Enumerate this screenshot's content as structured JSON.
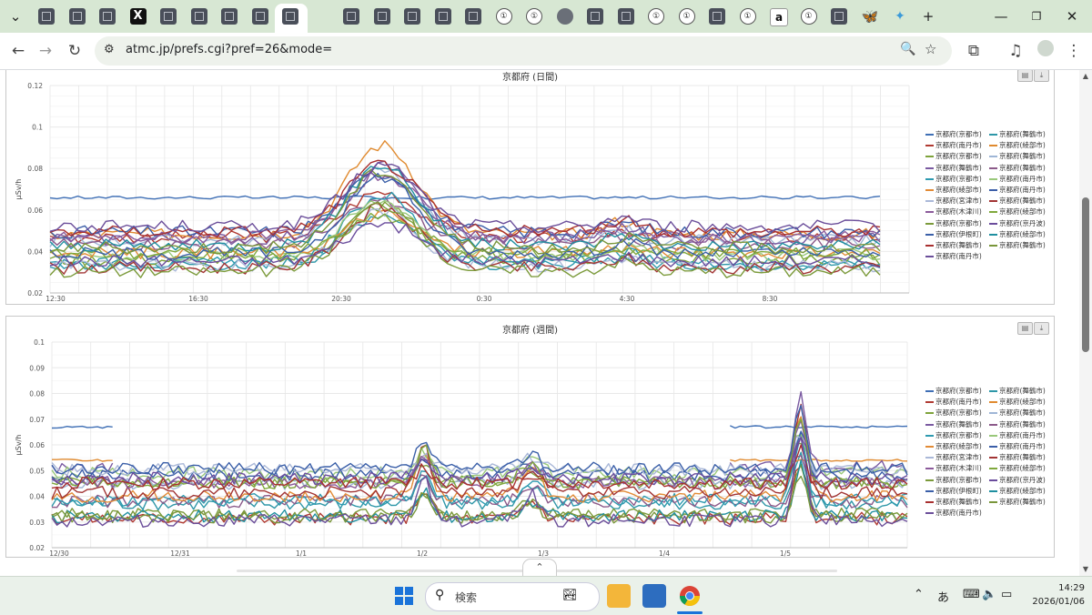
{
  "browser": {
    "tab_icons": [
      "site",
      "site",
      "site",
      "x",
      "site",
      "site",
      "site",
      "site",
      "site",
      "active",
      "site",
      "site",
      "site",
      "site",
      "site",
      "circ",
      "circ",
      "globe",
      "site",
      "site",
      "circ",
      "circ",
      "site",
      "circ",
      "amz",
      "circ",
      "site",
      "bfly",
      "star"
    ],
    "url": "atmc.jp/prefs.cgi?pref=26&mode="
  },
  "legend_names": [
    "京都府(京都市)",
    "京都府(舞鶴市)",
    "京都府(南丹市)",
    "京都府(綾部市)",
    "京都府(京都市)",
    "京都府(舞鶴市)",
    "京都府(舞鶴市)",
    "京都府(舞鶴市)",
    "京都府(京都市)",
    "京都府(南丹市)",
    "京都府(綾部市)",
    "京都府(南丹市)",
    "京都府(宮津市)",
    "京都府(舞鶴市)",
    "京都府(木津川)",
    "京都府(綾部市)",
    "京都府(京都市)",
    "京都府(京丹波)",
    "京都府(伊根町)",
    "京都府(綾部市)",
    "京都府(舞鶴市)",
    "京都府(舞鶴市)",
    "京都府(南丹市)"
  ],
  "legend_colors": [
    "#3f6fb5",
    "#2e97a8",
    "#b03a32",
    "#e08a2f",
    "#7ea33b",
    "#9fb6d6",
    "#7a5aa1",
    "#8c5a8a",
    "#2e9ab0",
    "#99c87a",
    "#e28b36",
    "#3b5ea8",
    "#aab8d8",
    "#a23434",
    "#8b5a9b",
    "#7fa83c",
    "#7b9a3a",
    "#6a4c9c",
    "#3a5fa8",
    "#1f8fa0",
    "#a83030",
    "#79963a",
    "#6b4e9a"
  ],
  "chart_data": [
    {
      "type": "line",
      "title": "京都府 (日間)",
      "ylabel": "μSv/h",
      "yticks": [
        "0.02",
        "0.04",
        "0.06",
        "0.08",
        "0.1",
        "0.12"
      ],
      "ylim": [
        0.02,
        0.12
      ],
      "xticks": [
        "12:30",
        "16:30",
        "20:30",
        "0:30",
        "4:30",
        "8:30"
      ],
      "grid": true,
      "legend_position": "right",
      "buttons": [
        "print",
        "download"
      ],
      "series_samples": [
        {
          "name": "京都府(京都市)",
          "values": [
            0.066,
            0.066,
            0.067,
            0.067,
            0.066,
            0.067,
            0.067,
            0.066,
            0.067
          ]
        },
        {
          "name": "京都府(舞鶴市)",
          "values": [
            0.032,
            0.033,
            0.034,
            0.032,
            0.045,
            0.1,
            0.065,
            0.048,
            0.04
          ]
        },
        {
          "name": "京都府(南丹市)",
          "values": [
            0.03,
            0.032,
            0.035,
            0.033,
            0.06,
            0.09,
            0.055,
            0.05,
            0.045
          ]
        },
        {
          "name": "京都府(綾部市)",
          "values": [
            0.054,
            0.054,
            0.054,
            0.054,
            0.054,
            0.055,
            0.054,
            0.054,
            0.053
          ]
        },
        {
          "name": "京都府(京都市)",
          "values": [
            0.026,
            0.026,
            0.027,
            0.027,
            0.035,
            0.075,
            0.03,
            0.028,
            0.028
          ]
        }
      ]
    },
    {
      "type": "line",
      "title": "京都府 (週間)",
      "ylabel": "μSv/h",
      "yticks": [
        "0.02",
        "0.03",
        "0.04",
        "0.05",
        "0.06",
        "0.07",
        "0.08",
        "0.09",
        "0.1"
      ],
      "ylim": [
        0.02,
        0.1
      ],
      "xticks": [
        "12/30",
        "12/31",
        "1/1",
        "1/2",
        "1/3",
        "1/4",
        "1/5"
      ],
      "grid": true,
      "legend_position": "right",
      "buttons": [
        "print",
        "download"
      ],
      "series_samples": [
        {
          "name": "京都府(京都市)",
          "values": [
            0.067,
            0.066,
            null,
            null,
            null,
            null,
            0.067,
            0.067,
            0.067
          ]
        },
        {
          "name": "京都府(舞鶴市)",
          "values": [
            0.03,
            0.031,
            0.03,
            0.04,
            0.035,
            0.03,
            0.032,
            0.09,
            0.035
          ]
        },
        {
          "name": "京都府(南丹市)",
          "values": [
            0.045,
            0.046,
            0.048,
            0.05,
            0.047,
            0.046,
            0.047,
            0.08,
            0.05
          ]
        },
        {
          "name": "京都府(綾部市)",
          "values": [
            0.054,
            0.054,
            null,
            null,
            null,
            null,
            0.055,
            0.056,
            0.055
          ]
        },
        {
          "name": "京都府(舞鶴市)",
          "values": [
            0.028,
            0.028,
            0.029,
            0.048,
            0.04,
            0.028,
            0.028,
            0.07,
            0.03
          ]
        }
      ]
    }
  ],
  "taskbar": {
    "search_placeholder": "検索",
    "ime": "あ",
    "time": "14:29",
    "date": "2026/01/06"
  }
}
